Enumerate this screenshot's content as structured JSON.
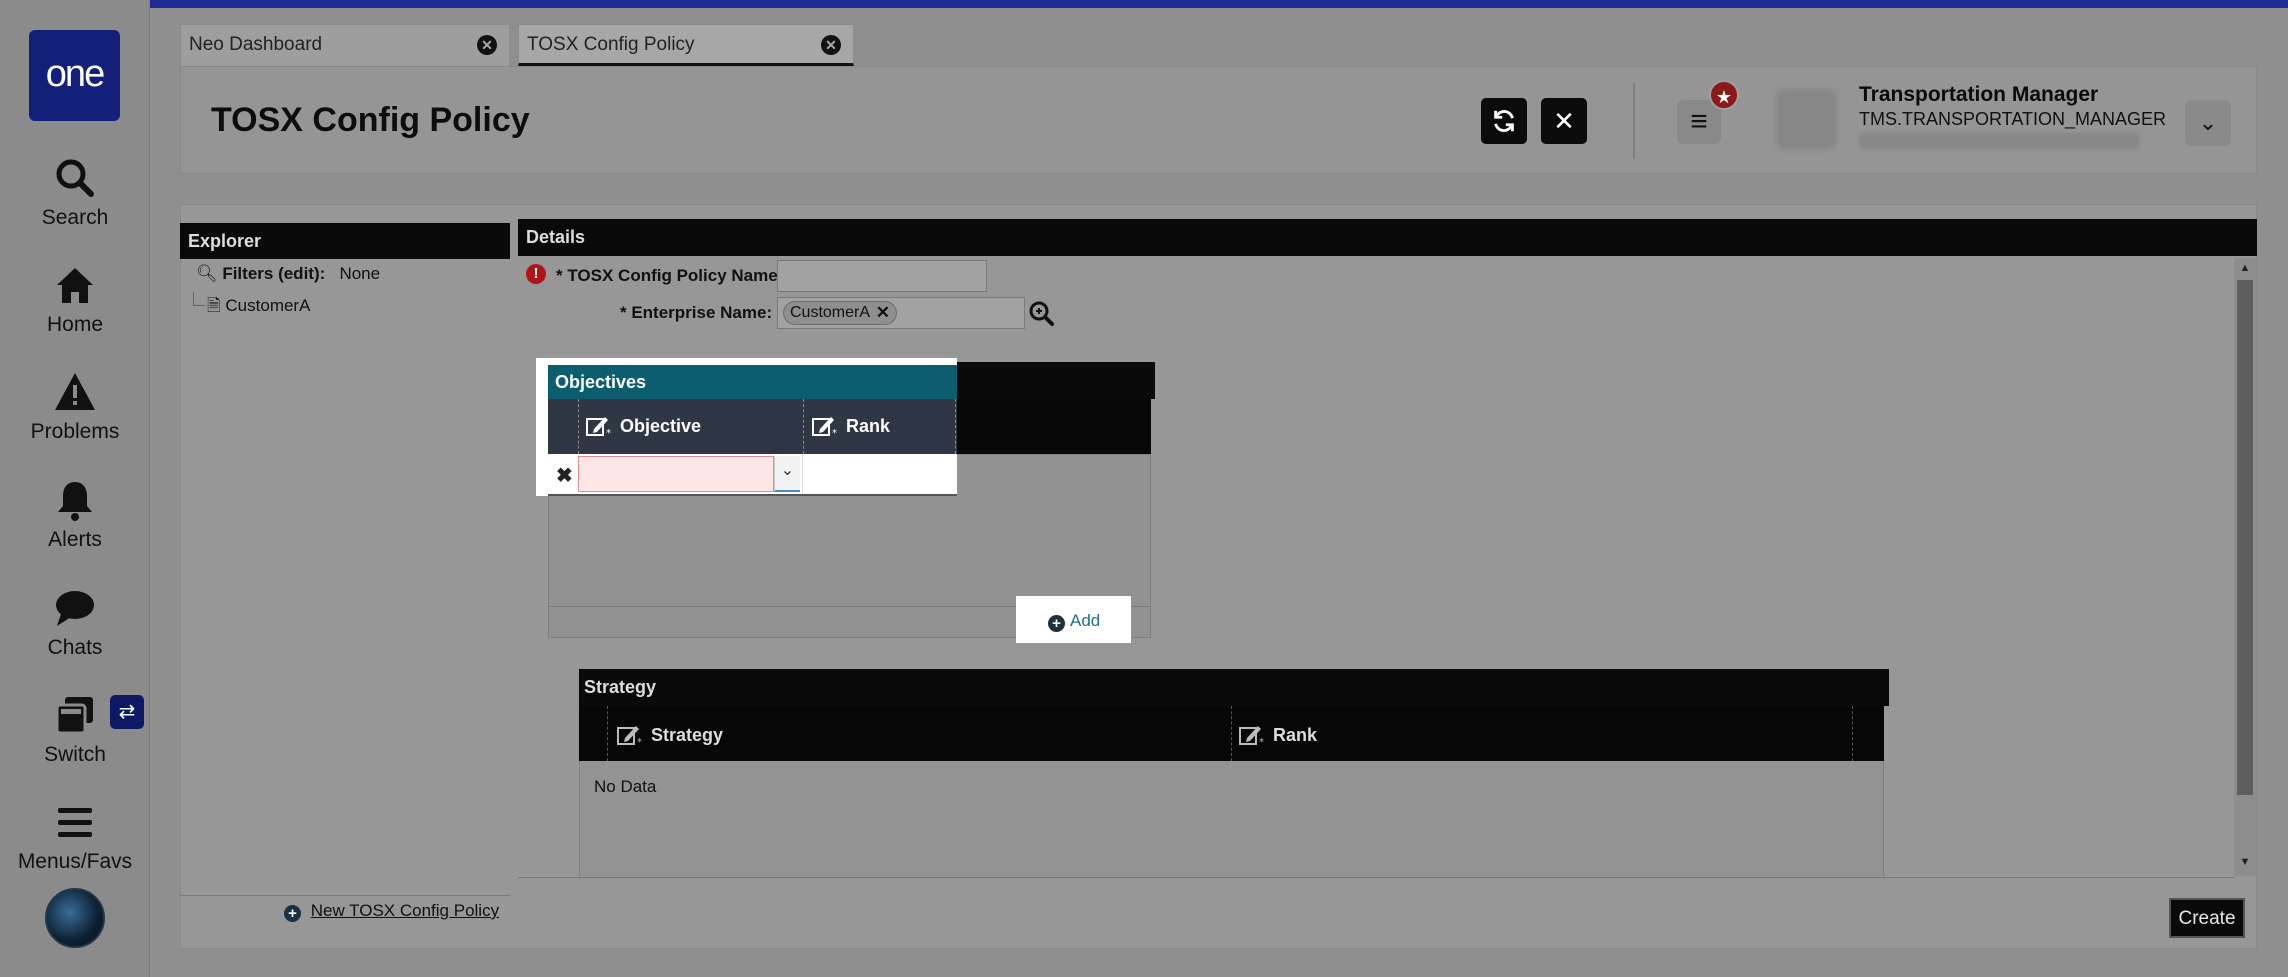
{
  "nav": {
    "logo": "one",
    "items": [
      {
        "label": "Search"
      },
      {
        "label": "Home"
      },
      {
        "label": "Problems"
      },
      {
        "label": "Alerts"
      },
      {
        "label": "Chats"
      },
      {
        "label": "Switch"
      },
      {
        "label": "Menus/Favs"
      }
    ]
  },
  "tabs": [
    {
      "label": "Neo Dashboard",
      "active": false
    },
    {
      "label": "TOSX Config Policy",
      "active": true
    }
  ],
  "header": {
    "title": "TOSX Config Policy",
    "user_name": "Transportation Manager",
    "user_role": "TMS.TRANSPORTATION_MANAGER"
  },
  "explorer": {
    "title": "Explorer",
    "filters_label": "Filters (edit):",
    "filters_value": "None",
    "tree_item": "CustomerA",
    "new_link": "New TOSX Config Policy"
  },
  "details": {
    "title": "Details",
    "name_label": "* TOSX Config Policy Name:",
    "name_value": "",
    "enterprise_label": "* Enterprise Name:",
    "enterprise_value": "CustomerA"
  },
  "objectives": {
    "title": "Objectives",
    "columns": [
      "Objective",
      "Rank"
    ],
    "add_label": "Add"
  },
  "strategy": {
    "title": "Strategy",
    "columns": [
      "Strategy",
      "Rank"
    ],
    "empty_text": "No Data"
  },
  "footer": {
    "create_label": "Create"
  },
  "colors": {
    "accent": "#1f2b95",
    "objectives_header": "#0c5d6e",
    "error": "#b0141a"
  }
}
